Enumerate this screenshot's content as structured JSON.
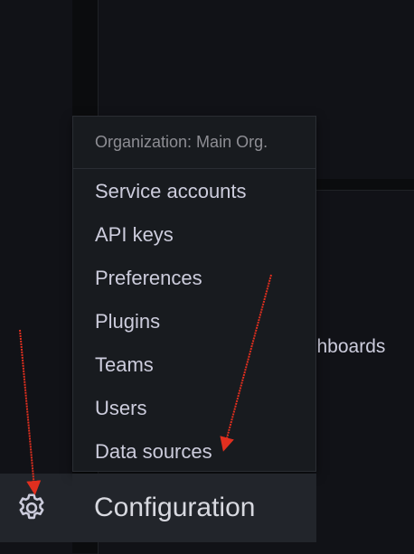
{
  "menu": {
    "header": "Organization: Main Org.",
    "items": [
      {
        "label": "Service accounts"
      },
      {
        "label": "API keys"
      },
      {
        "label": "Preferences"
      },
      {
        "label": "Plugins"
      },
      {
        "label": "Teams"
      },
      {
        "label": "Users"
      },
      {
        "label": "Data sources"
      }
    ],
    "section_title": "Configuration"
  },
  "background": {
    "dashboards_text": "shboards"
  },
  "icons": {
    "sidebar_configuration": "gear-icon"
  },
  "colors": {
    "background": "#111217",
    "menu_background": "#181b1f",
    "active_item_background": "#22252b",
    "text": "#ccccdc",
    "header_text": "#8e8e94",
    "annotation_arrow": "#e02f1f"
  }
}
